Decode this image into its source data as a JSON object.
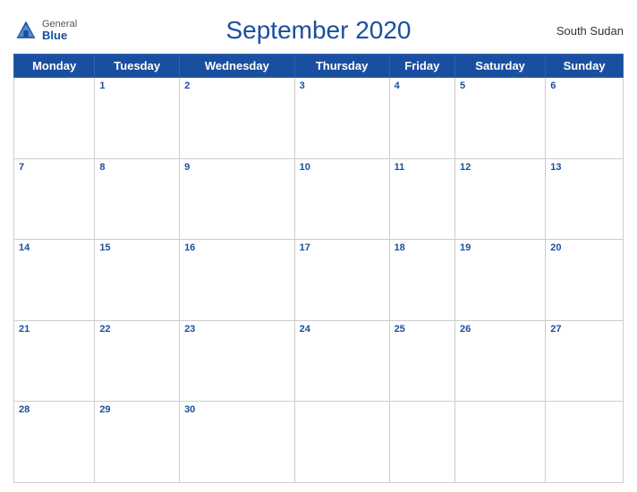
{
  "header": {
    "title": "September 2020",
    "country": "South Sudan",
    "logo_general": "General",
    "logo_blue": "Blue"
  },
  "weekdays": [
    "Monday",
    "Tuesday",
    "Wednesday",
    "Thursday",
    "Friday",
    "Saturday",
    "Sunday"
  ],
  "weeks": [
    [
      null,
      1,
      2,
      3,
      4,
      5,
      6
    ],
    [
      7,
      8,
      9,
      10,
      11,
      12,
      13
    ],
    [
      14,
      15,
      16,
      17,
      18,
      19,
      20
    ],
    [
      21,
      22,
      23,
      24,
      25,
      26,
      27
    ],
    [
      28,
      29,
      30,
      null,
      null,
      null,
      null
    ]
  ]
}
